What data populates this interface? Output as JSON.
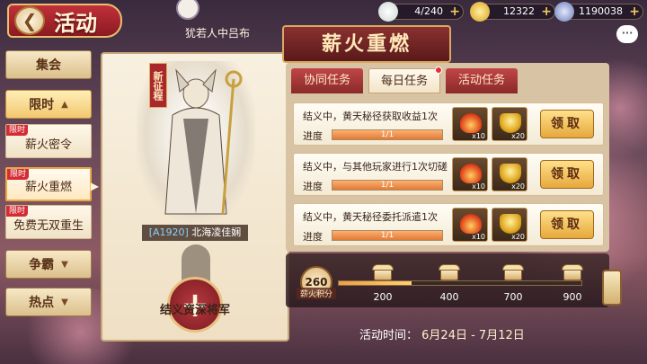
{
  "app": {
    "title": "活动",
    "back_icon": "back-arrow-icon"
  },
  "resources": [
    {
      "name": "stamina",
      "value": "4/240",
      "icon": "stamina-coin-icon"
    },
    {
      "name": "gold",
      "value": "12322",
      "icon": "gold-ingot-icon"
    },
    {
      "name": "copper",
      "value": "1190038",
      "icon": "copper-coin-icon"
    }
  ],
  "chat_label": "···",
  "menu": {
    "items": [
      {
        "label": "集会",
        "caret": ""
      },
      {
        "label": "限时",
        "caret": "▲"
      },
      {
        "label": "争霸",
        "caret": "▼"
      },
      {
        "label": "热点",
        "caret": "▼"
      }
    ],
    "sub_items": [
      {
        "tag": "限时",
        "label": "薪火密令"
      },
      {
        "tag": "限时",
        "label": "薪火重燃"
      },
      {
        "tag": "限时",
        "label": "免费无双重生"
      }
    ]
  },
  "general": {
    "header": "犹若人中吕布",
    "badge": "新征程",
    "code": "[A1920]",
    "name": "北海凌佳娴",
    "recruit_label": "结义资深将军",
    "add_symbol": "+"
  },
  "event": {
    "title": "薪火重燃",
    "tabs": [
      "协同任务",
      "每日任务",
      "活动任务"
    ],
    "active_tab": "每日任务",
    "tasks": [
      {
        "desc": "结义中，黄天秘径获取收益1次",
        "progress_label": "进度",
        "progress_text": "1/1",
        "progress": 1.0,
        "rewards": [
          {
            "icon": "fire-icon",
            "qty": "x10"
          },
          {
            "icon": "gold-ingot-icon",
            "qty": "x20"
          }
        ],
        "button": "领取"
      },
      {
        "desc": "结义中，与其他玩家进行1次切磋",
        "progress_label": "进度",
        "progress_text": "1/1",
        "progress": 1.0,
        "rewards": [
          {
            "icon": "fire-icon",
            "qty": "x10"
          },
          {
            "icon": "gold-ingot-icon",
            "qty": "x20"
          }
        ],
        "button": "领取"
      },
      {
        "desc": "结义中，黄天秘径委托派遣1次",
        "progress_label": "进度",
        "progress_text": "1/1",
        "progress": 1.0,
        "rewards": [
          {
            "icon": "fire-icon",
            "qty": "x10"
          },
          {
            "icon": "gold-ingot-icon",
            "qty": "x20"
          }
        ],
        "button": "领取"
      }
    ],
    "score": "260",
    "score_label": "薪火积分",
    "milestones": [
      "200",
      "400",
      "700",
      "900"
    ],
    "milestone_progress": 0.3,
    "time_label": "活动时间：",
    "time_range": "6月24日 - 7月12日"
  },
  "colors": {
    "accent_red": "#a8282e",
    "gold": "#e6a83c",
    "panel": "#f4ead4"
  }
}
